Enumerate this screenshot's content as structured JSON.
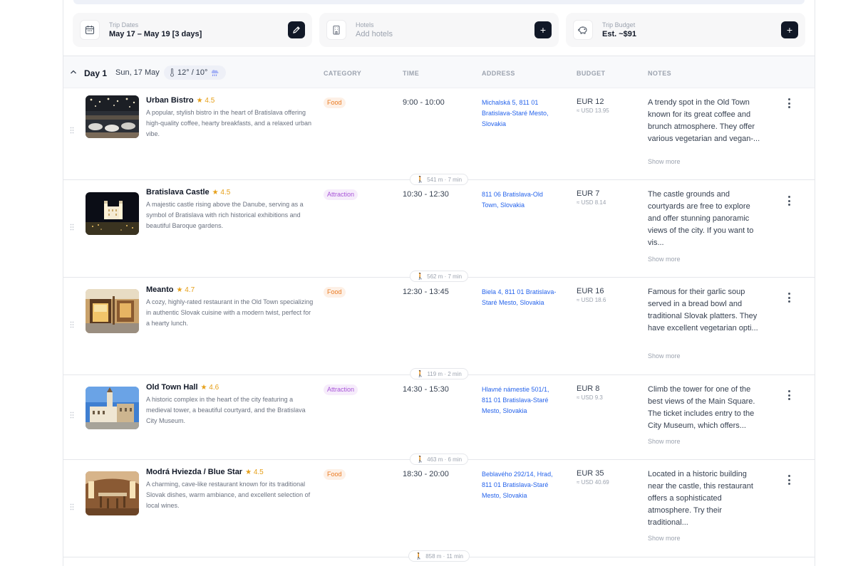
{
  "trip_cards": {
    "dates": {
      "label": "Trip Dates",
      "value": "May 17 – May 19 [3 days]",
      "icon": "calendar-icon",
      "action_icon": "pencil-icon"
    },
    "hotels": {
      "label": "Hotels",
      "value": "Add hotels",
      "icon": "building-icon",
      "action_icon": "plus-icon"
    },
    "budget": {
      "label": "Trip Budget",
      "value": "Est. ~$91",
      "icon": "piggy-bank-icon",
      "action_icon": "plus-icon"
    }
  },
  "day": {
    "title": "Day 1",
    "date": "Sun, 17 May",
    "weather": "12° / 10°",
    "columns": {
      "category": "CATEGORY",
      "time": "TIME",
      "address": "ADDRESS",
      "budget": "BUDGET",
      "notes": "NOTES"
    }
  },
  "activities": [
    {
      "name": "Urban Bistro",
      "rating": "★ 4.5",
      "description": "A popular, stylish bistro in the heart of Bratislava offering high-quality coffee, hearty breakfasts, and a relaxed urban vibe.",
      "category": "Food",
      "time": "9:00 - 10:00",
      "address": "Michalská 5, 811 01 Bratislava-Staré Mesto, Slovakia",
      "eur": "EUR 12",
      "usd": "≈ USD 13.95",
      "notes": "A trendy spot in the Old Town known for its great coffee and brunch atmosphere. They offer various vegetarian and vegan-...",
      "show_more": "Show more",
      "travel": "541 m · 7 min"
    },
    {
      "name": "Bratislava Castle",
      "rating": "★ 4.5",
      "description": "A majestic castle rising above the Danube, serving as a symbol of Bratislava with rich historical exhibitions and beautiful Baroque gardens.",
      "category": "Attraction",
      "time": "10:30 - 12:30",
      "address": "811 06 Bratislava-Old Town, Slovakia",
      "eur": "EUR 7",
      "usd": "≈ USD 8.14",
      "notes": "The castle grounds and courtyards are free to explore and offer stunning panoramic views of the city. If you want to vis...",
      "show_more": "Show more",
      "travel": "562 m · 7 min"
    },
    {
      "name": "Meanto",
      "rating": "★ 4.7",
      "description": "A cozy, highly-rated restaurant in the Old Town specializing in authentic Slovak cuisine with a modern twist, perfect for a hearty lunch.",
      "category": "Food",
      "time": "12:30 - 13:45",
      "address": "Biela 4, 811 01 Bratislava-Staré Mesto, Slovakia",
      "eur": "EUR 16",
      "usd": "≈ USD 18.6",
      "notes": "Famous for their garlic soup served in a bread bowl and traditional Slovak platters. They have excellent vegetarian opti...",
      "show_more": "Show more",
      "travel": "119 m · 2 min"
    },
    {
      "name": "Old Town Hall",
      "rating": "★ 4.6",
      "description": "A historic complex in the heart of the city featuring a medieval tower, a beautiful courtyard, and the Bratislava City Museum.",
      "category": "Attraction",
      "time": "14:30 - 15:30",
      "address": "Hlavné námestie 501/1, 811 01 Bratislava-Staré Mesto, Slovakia",
      "eur": "EUR 8",
      "usd": "≈ USD 9.3",
      "notes": "Climb the tower for one of the best views of the Main Square. The ticket includes entry to the City Museum, which offers...",
      "show_more": "Show more",
      "travel": "463 m · 6 min"
    },
    {
      "name": "Modrá Hviezda / Blue Star",
      "rating": "★ 4.5",
      "description": "A charming, cave-like restaurant known for its traditional Slovak dishes, warm ambiance, and excellent selection of local wines.",
      "category": "Food",
      "time": "18:30 - 20:00",
      "address": "Beblavého 292/14, Hrad, 811 01 Bratislava-Staré Mesto, Slovakia",
      "eur": "EUR 35",
      "usd": "≈ USD 40.69",
      "notes": "Located in a historic building near the castle, this restaurant offers a sophisticated atmosphere. Try their traditional...",
      "show_more": "Show more",
      "travel": "858 m · 11 min"
    }
  ]
}
